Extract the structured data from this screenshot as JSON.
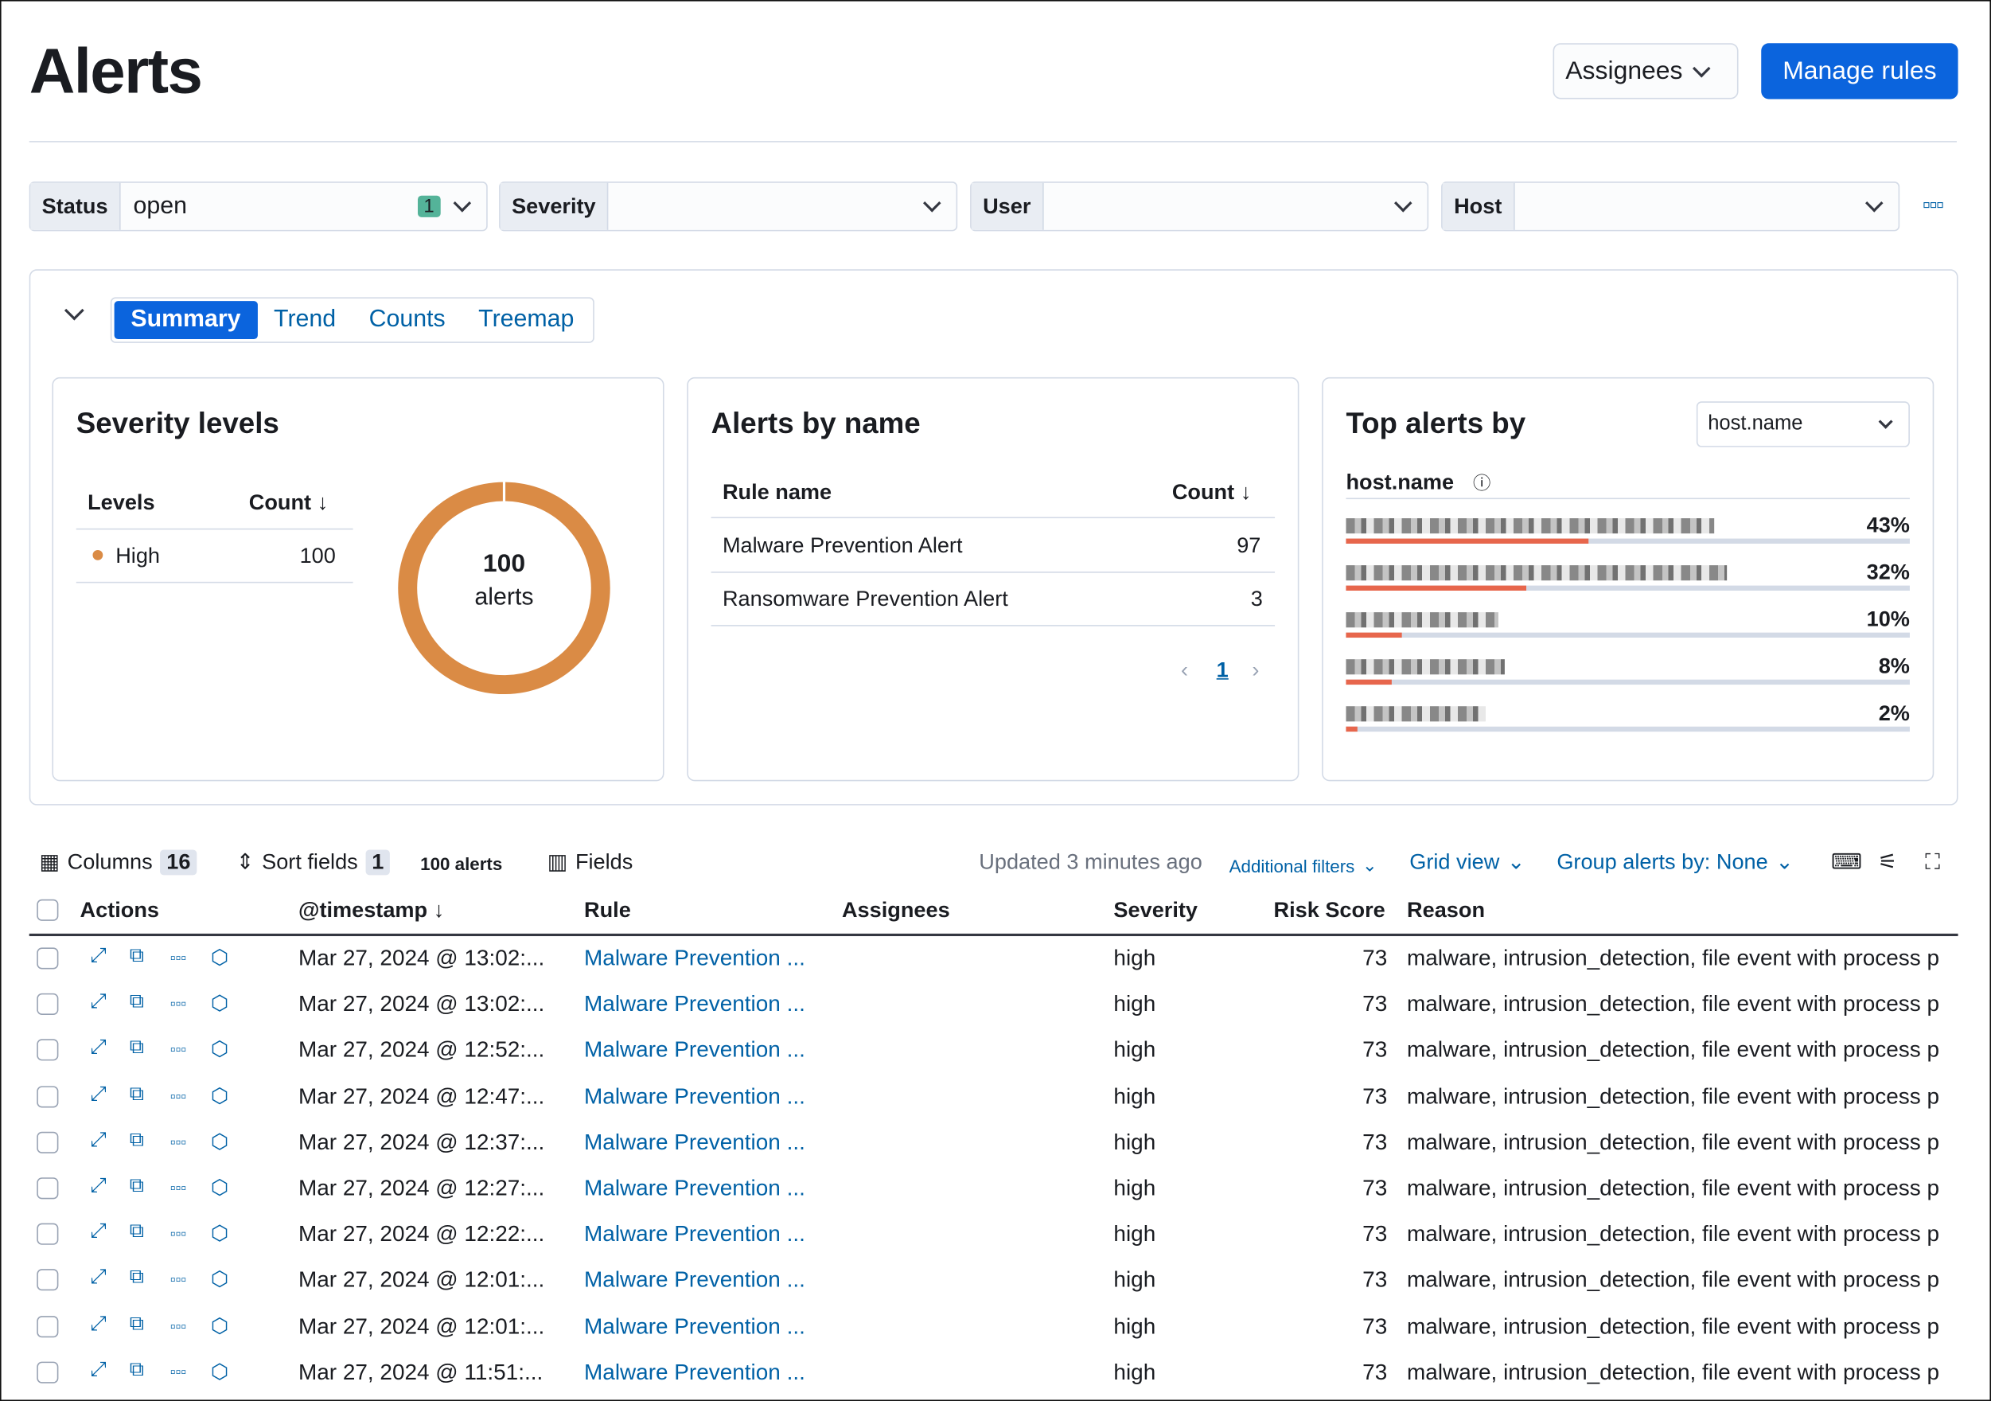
{
  "page": {
    "title": "Alerts",
    "assignees_label": "Assignees",
    "manage_rules_label": "Manage rules"
  },
  "filters": [
    {
      "label": "Status",
      "value": "open",
      "count": "1"
    },
    {
      "label": "Severity",
      "value": ""
    },
    {
      "label": "User",
      "value": ""
    },
    {
      "label": "Host",
      "value": ""
    }
  ],
  "tabs": [
    "Summary",
    "Trend",
    "Counts",
    "Treemap"
  ],
  "severity": {
    "title": "Severity levels",
    "col_levels": "Levels",
    "col_count": "Count",
    "rows": [
      {
        "level": "High",
        "count": "100",
        "color": "#da8b45"
      }
    ],
    "donut_total": "100",
    "donut_label": "alerts"
  },
  "by_name": {
    "title": "Alerts by name",
    "col_rule": "Rule name",
    "col_count": "Count",
    "rows": [
      {
        "name": "Malware Prevention Alert",
        "count": "97"
      },
      {
        "name": "Ransomware Prevention Alert",
        "count": "3"
      }
    ],
    "page": "1"
  },
  "top_alerts": {
    "title": "Top alerts by",
    "select": "host.name",
    "field_label": "host.name",
    "rows": [
      {
        "pct": "43%",
        "value": 43
      },
      {
        "pct": "32%",
        "value": 32
      },
      {
        "pct": "10%",
        "value": 10
      },
      {
        "pct": "8%",
        "value": 8
      },
      {
        "pct": "2%",
        "value": 2
      }
    ]
  },
  "toolbar": {
    "columns": "Columns",
    "columns_count": "16",
    "sort": "Sort fields",
    "sort_count": "1",
    "alerts_count": "100 alerts",
    "fields": "Fields",
    "updated": "Updated 3 minutes ago",
    "additional_filters": "Additional filters",
    "grid_view": "Grid view",
    "group_by": "Group alerts by: None"
  },
  "table": {
    "headers": [
      "Actions",
      "@timestamp",
      "Rule",
      "Assignees",
      "Severity",
      "Risk Score",
      "Reason"
    ],
    "rows": [
      {
        "ts": "Mar 27, 2024 @ 13:02:...",
        "rule": "Malware Prevention ...",
        "sev": "high",
        "risk": "73",
        "reason": "malware, intrusion_detection, file event with process p"
      },
      {
        "ts": "Mar 27, 2024 @ 13:02:...",
        "rule": "Malware Prevention ...",
        "sev": "high",
        "risk": "73",
        "reason": "malware, intrusion_detection, file event with process p"
      },
      {
        "ts": "Mar 27, 2024 @ 12:52:...",
        "rule": "Malware Prevention ...",
        "sev": "high",
        "risk": "73",
        "reason": "malware, intrusion_detection, file event with process p"
      },
      {
        "ts": "Mar 27, 2024 @ 12:47:...",
        "rule": "Malware Prevention ...",
        "sev": "high",
        "risk": "73",
        "reason": "malware, intrusion_detection, file event with process p"
      },
      {
        "ts": "Mar 27, 2024 @ 12:37:...",
        "rule": "Malware Prevention ...",
        "sev": "high",
        "risk": "73",
        "reason": "malware, intrusion_detection, file event with process p"
      },
      {
        "ts": "Mar 27, 2024 @ 12:27:...",
        "rule": "Malware Prevention ...",
        "sev": "high",
        "risk": "73",
        "reason": "malware, intrusion_detection, file event with process p"
      },
      {
        "ts": "Mar 27, 2024 @ 12:22:...",
        "rule": "Malware Prevention ...",
        "sev": "high",
        "risk": "73",
        "reason": "malware, intrusion_detection, file event with process p"
      },
      {
        "ts": "Mar 27, 2024 @ 12:01:...",
        "rule": "Malware Prevention ...",
        "sev": "high",
        "risk": "73",
        "reason": "malware, intrusion_detection, file event with process p"
      },
      {
        "ts": "Mar 27, 2024 @ 12:01:...",
        "rule": "Malware Prevention ...",
        "sev": "high",
        "risk": "73",
        "reason": "malware, intrusion_detection, file event with process p"
      },
      {
        "ts": "Mar 27, 2024 @ 11:51:...",
        "rule": "Malware Prevention ...",
        "sev": "high",
        "risk": "73",
        "reason": "malware, intrusion_detection, file event with process p"
      }
    ]
  }
}
